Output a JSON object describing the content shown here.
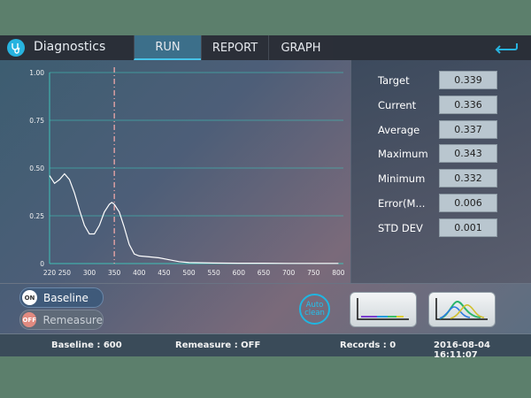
{
  "app": {
    "title": "Diagnostics"
  },
  "tabs": [
    {
      "label": "RUN",
      "active": true
    },
    {
      "label": "REPORT",
      "active": false
    },
    {
      "label": "GRAPH",
      "active": false
    }
  ],
  "chart_data": {
    "type": "line",
    "title": "",
    "xlabel": "",
    "ylabel": "",
    "xlim": [
      220,
      810
    ],
    "ylim": [
      0,
      1.0
    ],
    "x_ticks": [
      "220",
      "250",
      "300",
      "350",
      "400",
      "450",
      "500",
      "550",
      "600",
      "650",
      "700",
      "750",
      "800"
    ],
    "y_ticks": [
      "1.00",
      "0.75",
      "0.50",
      "0.25",
      "0"
    ],
    "marker_x": 350,
    "series": [
      {
        "color": "#ffffff",
        "points": [
          [
            220,
            0.46
          ],
          [
            230,
            0.42
          ],
          [
            240,
            0.44
          ],
          [
            250,
            0.47
          ],
          [
            260,
            0.44
          ],
          [
            270,
            0.37
          ],
          [
            280,
            0.28
          ],
          [
            290,
            0.2
          ],
          [
            300,
            0.155
          ],
          [
            310,
            0.155
          ],
          [
            320,
            0.2
          ],
          [
            330,
            0.27
          ],
          [
            340,
            0.31
          ],
          [
            345,
            0.32
          ],
          [
            350,
            0.31
          ],
          [
            360,
            0.27
          ],
          [
            370,
            0.19
          ],
          [
            380,
            0.1
          ],
          [
            390,
            0.05
          ],
          [
            400,
            0.04
          ],
          [
            420,
            0.035
          ],
          [
            440,
            0.03
          ],
          [
            460,
            0.02
          ],
          [
            480,
            0.01
          ],
          [
            500,
            0.005
          ],
          [
            550,
            0.003
          ],
          [
            600,
            0.002
          ],
          [
            650,
            0.002
          ],
          [
            700,
            0.001
          ],
          [
            750,
            0.001
          ],
          [
            800,
            0.001
          ]
        ]
      }
    ],
    "grid": true
  },
  "stats": [
    {
      "label": "Target",
      "value": "0.339"
    },
    {
      "label": "Current",
      "value": "0.336"
    },
    {
      "label": "Average",
      "value": "0.337"
    },
    {
      "label": "Maximum",
      "value": "0.343"
    },
    {
      "label": "Minimum",
      "value": "0.332"
    },
    {
      "label": "Error(M...",
      "value": "0.006"
    },
    {
      "label": "STD DEV",
      "value": "0.001"
    }
  ],
  "controls": {
    "baseline": {
      "state": "ON",
      "label": "Baseline"
    },
    "remeasure": {
      "state": "OFF",
      "label": "Remeasure"
    },
    "autoclean_line1": "Auto",
    "autoclean_line2": "clean"
  },
  "status": {
    "baseline": "Baseline : 600",
    "remeasure": "Remeasure : OFF",
    "records": "Records : 0",
    "datetime": "2016-08-04 16:11:07"
  },
  "colors": {
    "accent": "#27b3df",
    "grid": "#3fc0b6",
    "marker": "#f0a8a8"
  },
  "icons": [
    "stethoscope-icon",
    "back-arrow-icon",
    "spectrum-thumb-icon",
    "peak-thumb-icon"
  ]
}
